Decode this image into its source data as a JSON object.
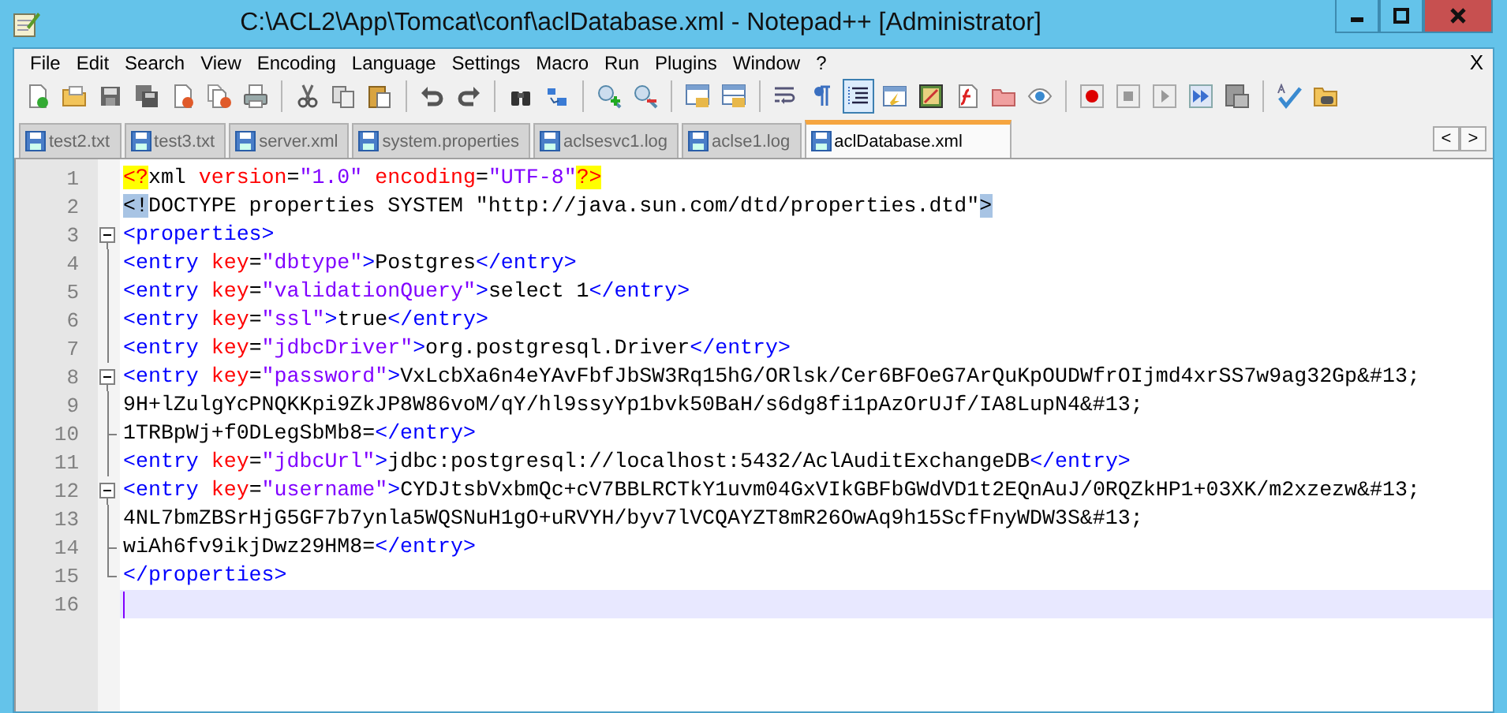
{
  "window": {
    "title": "C:\\ACL2\\App\\Tomcat\\conf\\aclDatabase.xml - Notepad++ [Administrator]"
  },
  "menu": {
    "items": [
      "File",
      "Edit",
      "Search",
      "View",
      "Encoding",
      "Language",
      "Settings",
      "Macro",
      "Run",
      "Plugins",
      "Window",
      "?"
    ],
    "close": "X"
  },
  "toolbar": [
    [
      {
        "pressed": false
      },
      {
        "pressed": false
      },
      {
        "pressed": false
      },
      {
        "pressed": false
      },
      {
        "pressed": false
      },
      {
        "pressed": false
      },
      {
        "pressed": false
      }
    ],
    [
      {
        "pressed": false
      },
      {
        "pressed": false
      },
      {
        "pressed": false
      }
    ],
    [
      {
        "pressed": false
      },
      {
        "pressed": false
      }
    ],
    [
      {
        "pressed": false
      },
      {
        "pressed": false
      }
    ],
    [
      {
        "pressed": false
      },
      {
        "pressed": false
      }
    ],
    [
      {
        "pressed": false
      },
      {
        "pressed": false
      }
    ],
    [
      {
        "pressed": false
      },
      {
        "pressed": false
      },
      {
        "pressed": true
      },
      {
        "pressed": false
      },
      {
        "pressed": false
      },
      {
        "pressed": false
      },
      {
        "pressed": false
      },
      {
        "pressed": false
      }
    ],
    [
      {
        "pressed": false
      },
      {
        "pressed": false
      },
      {
        "pressed": false
      },
      {
        "pressed": false
      },
      {
        "pressed": false
      }
    ],
    [
      {
        "pressed": false
      },
      {
        "pressed": false
      }
    ]
  ],
  "tabs": [
    {
      "label": "test2.txt",
      "selected": false
    },
    {
      "label": "test3.txt",
      "selected": false
    },
    {
      "label": "server.xml",
      "selected": false
    },
    {
      "label": "system.properties",
      "selected": false
    },
    {
      "label": "aclsesvc1.log",
      "selected": false
    },
    {
      "label": "aclse1.log",
      "selected": false
    },
    {
      "label": "aclDatabase.xml",
      "selected": true
    }
  ],
  "tab_scroll": [
    "<",
    ">"
  ],
  "editor": {
    "lines": [
      {
        "number": "1",
        "current": false,
        "kind": "plain",
        "tokens": [
          {
            "kind": "pi",
            "text": "<?"
          },
          {
            "kind": "text",
            "text": "xml "
          },
          {
            "kind": "attr",
            "text": "version"
          },
          {
            "kind": "text",
            "text": "="
          },
          {
            "kind": "value",
            "text": "\"1.0\""
          },
          {
            "kind": "attr",
            "text": " encoding"
          },
          {
            "kind": "text",
            "text": "="
          },
          {
            "kind": "value",
            "text": "\"UTF-8\""
          },
          {
            "kind": "pi",
            "text": "?>"
          }
        ]
      },
      {
        "number": "2",
        "current": false,
        "kind": "plain",
        "tokens": [
          {
            "kind": "match",
            "text": "<!"
          },
          {
            "kind": "text",
            "text": "DOCTYPE properties SYSTEM \"http://java.sun.com/dtd/properties.dtd\""
          },
          {
            "kind": "match",
            "text": ">"
          }
        ]
      },
      {
        "number": "3",
        "current": false,
        "kind": "fold-start",
        "tokens": [
          {
            "kind": "tag",
            "text": "<properties>"
          }
        ]
      },
      {
        "number": "4",
        "current": false,
        "kind": "fold-body",
        "tokens": [
          {
            "kind": "tag",
            "text": "<entry "
          },
          {
            "kind": "attr",
            "text": "key"
          },
          {
            "kind": "text",
            "text": "="
          },
          {
            "kind": "value",
            "text": "\"dbtype\""
          },
          {
            "kind": "tag",
            "text": ">"
          },
          {
            "kind": "text",
            "text": "Postgres"
          },
          {
            "kind": "tag",
            "text": "</entry>"
          }
        ]
      },
      {
        "number": "5",
        "current": false,
        "kind": "fold-body",
        "tokens": [
          {
            "kind": "tag",
            "text": "<entry "
          },
          {
            "kind": "attr",
            "text": "key"
          },
          {
            "kind": "text",
            "text": "="
          },
          {
            "kind": "value",
            "text": "\"validationQuery\""
          },
          {
            "kind": "tag",
            "text": ">"
          },
          {
            "kind": "text",
            "text": "select 1"
          },
          {
            "kind": "tag",
            "text": "</entry>"
          }
        ]
      },
      {
        "number": "6",
        "current": false,
        "kind": "fold-body",
        "tokens": [
          {
            "kind": "tag",
            "text": "<entry "
          },
          {
            "kind": "attr",
            "text": "key"
          },
          {
            "kind": "text",
            "text": "="
          },
          {
            "kind": "value",
            "text": "\"ssl\""
          },
          {
            "kind": "tag",
            "text": ">"
          },
          {
            "kind": "text",
            "text": "true"
          },
          {
            "kind": "tag",
            "text": "</entry>"
          }
        ]
      },
      {
        "number": "7",
        "current": false,
        "kind": "fold-body",
        "tokens": [
          {
            "kind": "tag",
            "text": "<entry "
          },
          {
            "kind": "attr",
            "text": "key"
          },
          {
            "kind": "text",
            "text": "="
          },
          {
            "kind": "value",
            "text": "\"jdbcDriver\""
          },
          {
            "kind": "tag",
            "text": ">"
          },
          {
            "kind": "text",
            "text": "org.postgresql.Driver"
          },
          {
            "kind": "tag",
            "text": "</entry>"
          }
        ]
      },
      {
        "number": "8",
        "current": false,
        "kind": "fold-start",
        "tokens": [
          {
            "kind": "tag",
            "text": "<entry "
          },
          {
            "kind": "attr",
            "text": "key"
          },
          {
            "kind": "text",
            "text": "="
          },
          {
            "kind": "value",
            "text": "\"password\""
          },
          {
            "kind": "tag",
            "text": ">"
          },
          {
            "kind": "text",
            "text": "VxLcbXa6n4eYAvFbfJbSW3Rq15hG/ORlsk/Cer6BFOeG7ArQuKpOUDWfrOIjmd4xrSS7w9ag32Gp&#13;"
          }
        ]
      },
      {
        "number": "9",
        "current": false,
        "kind": "fold-body",
        "tokens": [
          {
            "kind": "text",
            "text": "9H+lZulgYcPNQKKpi9ZkJP8W86voM/qY/hl9ssyYp1bvk50BaH/s6dg8fi1pAzOrUJf/IA8LupN4&#13;"
          }
        ]
      },
      {
        "number": "10",
        "current": false,
        "kind": "fold-tick",
        "tokens": [
          {
            "kind": "text",
            "text": "1TRBpWj+f0DLegSbMb8="
          },
          {
            "kind": "tag",
            "text": "</entry>"
          }
        ]
      },
      {
        "number": "11",
        "current": false,
        "kind": "fold-body",
        "tokens": [
          {
            "kind": "tag",
            "text": "<entry "
          },
          {
            "kind": "attr",
            "text": "key"
          },
          {
            "kind": "text",
            "text": "="
          },
          {
            "kind": "value",
            "text": "\"jdbcUrl\""
          },
          {
            "kind": "tag",
            "text": ">"
          },
          {
            "kind": "text",
            "text": "jdbc:postgresql://localhost:5432/AclAuditExchangeDB"
          },
          {
            "kind": "tag",
            "text": "</entry>"
          }
        ]
      },
      {
        "number": "12",
        "current": false,
        "kind": "fold-start",
        "tokens": [
          {
            "kind": "tag",
            "text": "<entry "
          },
          {
            "kind": "attr",
            "text": "key"
          },
          {
            "kind": "text",
            "text": "="
          },
          {
            "kind": "value",
            "text": "\"username\""
          },
          {
            "kind": "tag",
            "text": ">"
          },
          {
            "kind": "text",
            "text": "CYDJtsbVxbmQc+cV7BBLRCTkY1uvm04GxVIkGBFbGWdVD1t2EQnAuJ/0RQZkHP1+03XK/m2xzezw&#13;"
          }
        ]
      },
      {
        "number": "13",
        "current": false,
        "kind": "fold-body",
        "tokens": [
          {
            "kind": "text",
            "text": "4NL7bmZBSrHjG5GF7b7ynla5WQSNuH1gO+uRVYH/byv7lVCQAYZT8mR26OwAq9h15ScfFnyWDW3S&#13;"
          }
        ]
      },
      {
        "number": "14",
        "current": false,
        "kind": "fold-tick",
        "tokens": [
          {
            "kind": "text",
            "text": "wiAh6fv9ikjDwz29HM8="
          },
          {
            "kind": "tag",
            "text": "</entry>"
          }
        ]
      },
      {
        "number": "15",
        "current": false,
        "kind": "fold-end",
        "tokens": [
          {
            "kind": "tag",
            "text": "</properties>"
          }
        ]
      },
      {
        "number": "16",
        "current": true,
        "kind": "plain"
      }
    ]
  }
}
